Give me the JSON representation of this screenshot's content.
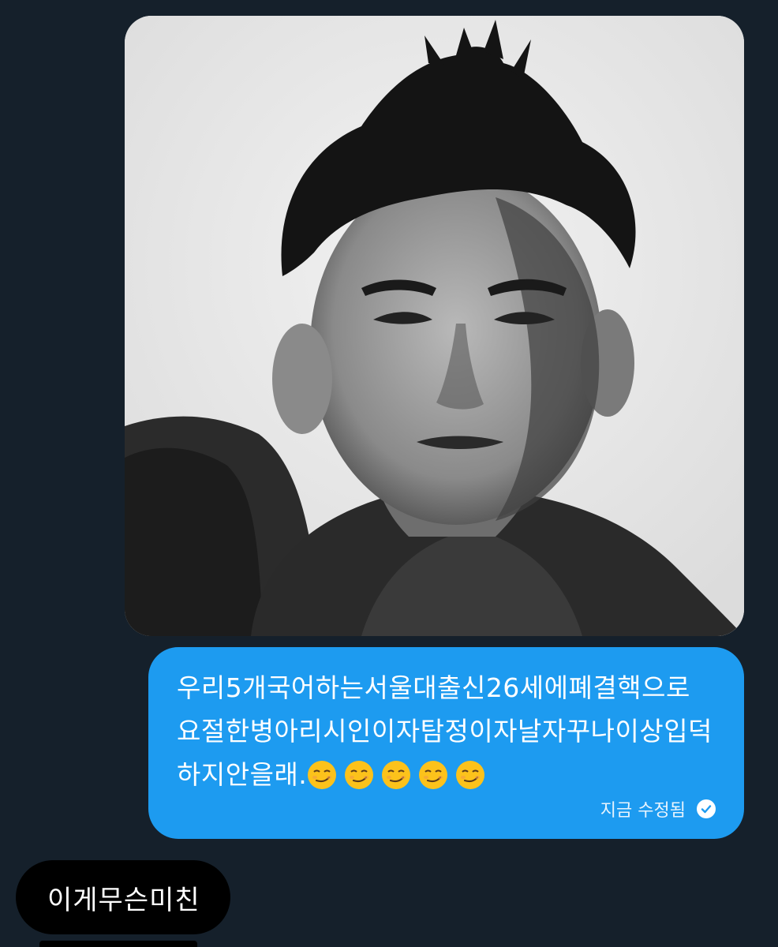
{
  "conversation": {
    "image_message": {
      "alt_icon": "photo-portrait"
    },
    "sent_message": {
      "text": "우리5개국어하는서울대출신26세에폐결핵으로요절한병아리시인이자탐정이자날자꾸나이상입덕하지안을래.",
      "emoji_icon": "smirking-face-icon",
      "emoji_count": 5,
      "status": "지금 수정됨",
      "status_icon": "check-circle-icon"
    },
    "received_message": {
      "text": "이게무슨미친"
    }
  },
  "colors": {
    "background": "#15202b",
    "sent_bubble": "#1d9bf0",
    "received_bubble": "#000000"
  }
}
